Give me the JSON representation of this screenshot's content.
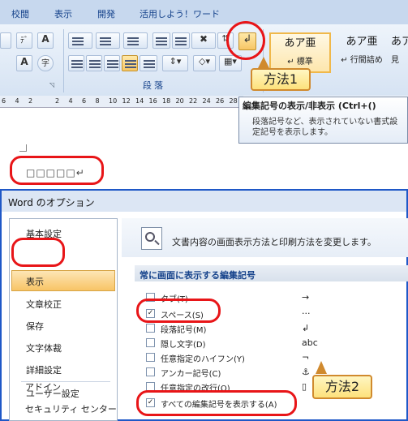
{
  "ribbon": {
    "tabs": [
      "校閲",
      "表示",
      "開発",
      "活用しよう！ワード"
    ],
    "group_label": "段落",
    "pilcrow_button_glyph": "↲",
    "styles": [
      {
        "name": "あア亜",
        "sub": "↵ 標準"
      },
      {
        "name": "あア亜",
        "sub": "↵ 行間詰め"
      },
      {
        "name": "あア",
        "sub": "見"
      }
    ],
    "font_buttons": [
      "ﾃﾞ",
      "A",
      "A",
      "字"
    ]
  },
  "ruler": {
    "ticks": [
      "6",
      "4",
      "2",
      "",
      "2",
      "4",
      "6",
      "8",
      "10",
      "12",
      "14",
      "16",
      "18",
      "20",
      "22",
      "24",
      "26",
      "28"
    ]
  },
  "tooltip": {
    "title": "編集記号の表示/非表示 (Ctrl+()",
    "body": "段落記号など、表示されていない書式設定記号を表示します。"
  },
  "document": {
    "text": "□□□□□↵"
  },
  "dialog": {
    "title": "Word のオプション",
    "sidebar": [
      "基本設定",
      "表示",
      "文章校正",
      "保存",
      "文字体裁",
      "詳細設定",
      "ユーザー設定",
      "アドイン",
      "セキュリティ センター"
    ],
    "selected": "表示",
    "header_text": "文書内容の画面表示方法と印刷方法を変更します。",
    "section_title": "常に画面に表示する編集記号",
    "options": [
      {
        "label": "タブ(T)",
        "checked": false,
        "symbol": "→"
      },
      {
        "label": "スペース(S)",
        "checked": true,
        "symbol": "···"
      },
      {
        "label": "段落記号(M)",
        "checked": false,
        "symbol": "↲"
      },
      {
        "label": "隠し文字(D)",
        "checked": false,
        "symbol": "abc"
      },
      {
        "label": "任意指定のハイフン(Y)",
        "checked": false,
        "symbol": "¬"
      },
      {
        "label": "アンカー記号(C)",
        "checked": false,
        "symbol": "⚓"
      },
      {
        "label": "任意指定の改行(O)",
        "checked": false,
        "symbol": "▯"
      },
      {
        "label": "すべての編集記号を表示する(A)",
        "checked": true,
        "symbol": ""
      }
    ]
  },
  "callouts": {
    "method1": "方法1",
    "method2": "方法2"
  },
  "colors": {
    "highlight": "#e81518",
    "dialog_border": "#1f58c7"
  }
}
